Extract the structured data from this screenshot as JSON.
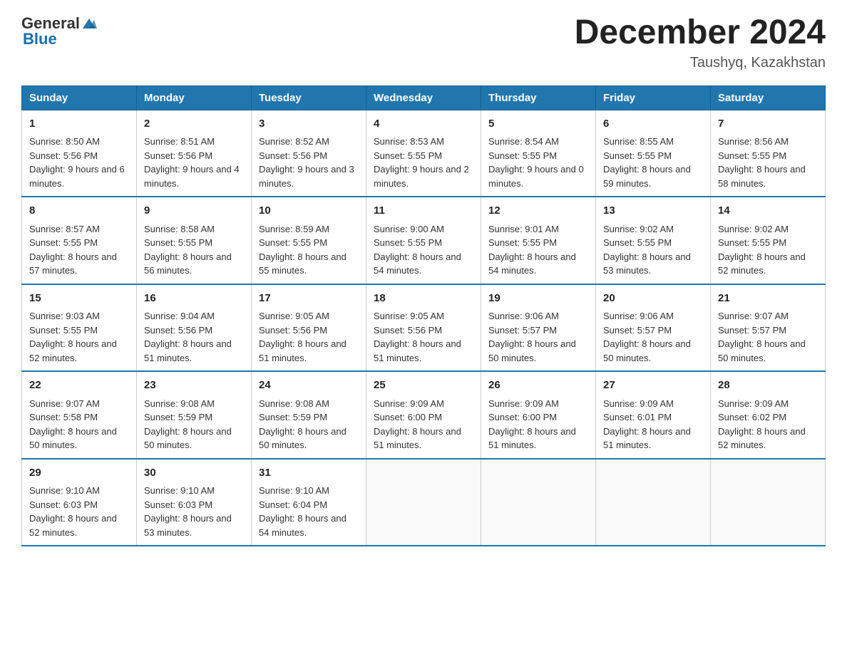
{
  "header": {
    "logo_general": "General",
    "logo_blue": "Blue",
    "title": "December 2024",
    "location": "Taushyq, Kazakhstan"
  },
  "days_of_week": [
    "Sunday",
    "Monday",
    "Tuesday",
    "Wednesday",
    "Thursday",
    "Friday",
    "Saturday"
  ],
  "weeks": [
    [
      {
        "day": "1",
        "sunrise": "Sunrise: 8:50 AM",
        "sunset": "Sunset: 5:56 PM",
        "daylight": "Daylight: 9 hours and 6 minutes."
      },
      {
        "day": "2",
        "sunrise": "Sunrise: 8:51 AM",
        "sunset": "Sunset: 5:56 PM",
        "daylight": "Daylight: 9 hours and 4 minutes."
      },
      {
        "day": "3",
        "sunrise": "Sunrise: 8:52 AM",
        "sunset": "Sunset: 5:56 PM",
        "daylight": "Daylight: 9 hours and 3 minutes."
      },
      {
        "day": "4",
        "sunrise": "Sunrise: 8:53 AM",
        "sunset": "Sunset: 5:55 PM",
        "daylight": "Daylight: 9 hours and 2 minutes."
      },
      {
        "day": "5",
        "sunrise": "Sunrise: 8:54 AM",
        "sunset": "Sunset: 5:55 PM",
        "daylight": "Daylight: 9 hours and 0 minutes."
      },
      {
        "day": "6",
        "sunrise": "Sunrise: 8:55 AM",
        "sunset": "Sunset: 5:55 PM",
        "daylight": "Daylight: 8 hours and 59 minutes."
      },
      {
        "day": "7",
        "sunrise": "Sunrise: 8:56 AM",
        "sunset": "Sunset: 5:55 PM",
        "daylight": "Daylight: 8 hours and 58 minutes."
      }
    ],
    [
      {
        "day": "8",
        "sunrise": "Sunrise: 8:57 AM",
        "sunset": "Sunset: 5:55 PM",
        "daylight": "Daylight: 8 hours and 57 minutes."
      },
      {
        "day": "9",
        "sunrise": "Sunrise: 8:58 AM",
        "sunset": "Sunset: 5:55 PM",
        "daylight": "Daylight: 8 hours and 56 minutes."
      },
      {
        "day": "10",
        "sunrise": "Sunrise: 8:59 AM",
        "sunset": "Sunset: 5:55 PM",
        "daylight": "Daylight: 8 hours and 55 minutes."
      },
      {
        "day": "11",
        "sunrise": "Sunrise: 9:00 AM",
        "sunset": "Sunset: 5:55 PM",
        "daylight": "Daylight: 8 hours and 54 minutes."
      },
      {
        "day": "12",
        "sunrise": "Sunrise: 9:01 AM",
        "sunset": "Sunset: 5:55 PM",
        "daylight": "Daylight: 8 hours and 54 minutes."
      },
      {
        "day": "13",
        "sunrise": "Sunrise: 9:02 AM",
        "sunset": "Sunset: 5:55 PM",
        "daylight": "Daylight: 8 hours and 53 minutes."
      },
      {
        "day": "14",
        "sunrise": "Sunrise: 9:02 AM",
        "sunset": "Sunset: 5:55 PM",
        "daylight": "Daylight: 8 hours and 52 minutes."
      }
    ],
    [
      {
        "day": "15",
        "sunrise": "Sunrise: 9:03 AM",
        "sunset": "Sunset: 5:55 PM",
        "daylight": "Daylight: 8 hours and 52 minutes."
      },
      {
        "day": "16",
        "sunrise": "Sunrise: 9:04 AM",
        "sunset": "Sunset: 5:56 PM",
        "daylight": "Daylight: 8 hours and 51 minutes."
      },
      {
        "day": "17",
        "sunrise": "Sunrise: 9:05 AM",
        "sunset": "Sunset: 5:56 PM",
        "daylight": "Daylight: 8 hours and 51 minutes."
      },
      {
        "day": "18",
        "sunrise": "Sunrise: 9:05 AM",
        "sunset": "Sunset: 5:56 PM",
        "daylight": "Daylight: 8 hours and 51 minutes."
      },
      {
        "day": "19",
        "sunrise": "Sunrise: 9:06 AM",
        "sunset": "Sunset: 5:57 PM",
        "daylight": "Daylight: 8 hours and 50 minutes."
      },
      {
        "day": "20",
        "sunrise": "Sunrise: 9:06 AM",
        "sunset": "Sunset: 5:57 PM",
        "daylight": "Daylight: 8 hours and 50 minutes."
      },
      {
        "day": "21",
        "sunrise": "Sunrise: 9:07 AM",
        "sunset": "Sunset: 5:57 PM",
        "daylight": "Daylight: 8 hours and 50 minutes."
      }
    ],
    [
      {
        "day": "22",
        "sunrise": "Sunrise: 9:07 AM",
        "sunset": "Sunset: 5:58 PM",
        "daylight": "Daylight: 8 hours and 50 minutes."
      },
      {
        "day": "23",
        "sunrise": "Sunrise: 9:08 AM",
        "sunset": "Sunset: 5:59 PM",
        "daylight": "Daylight: 8 hours and 50 minutes."
      },
      {
        "day": "24",
        "sunrise": "Sunrise: 9:08 AM",
        "sunset": "Sunset: 5:59 PM",
        "daylight": "Daylight: 8 hours and 50 minutes."
      },
      {
        "day": "25",
        "sunrise": "Sunrise: 9:09 AM",
        "sunset": "Sunset: 6:00 PM",
        "daylight": "Daylight: 8 hours and 51 minutes."
      },
      {
        "day": "26",
        "sunrise": "Sunrise: 9:09 AM",
        "sunset": "Sunset: 6:00 PM",
        "daylight": "Daylight: 8 hours and 51 minutes."
      },
      {
        "day": "27",
        "sunrise": "Sunrise: 9:09 AM",
        "sunset": "Sunset: 6:01 PM",
        "daylight": "Daylight: 8 hours and 51 minutes."
      },
      {
        "day": "28",
        "sunrise": "Sunrise: 9:09 AM",
        "sunset": "Sunset: 6:02 PM",
        "daylight": "Daylight: 8 hours and 52 minutes."
      }
    ],
    [
      {
        "day": "29",
        "sunrise": "Sunrise: 9:10 AM",
        "sunset": "Sunset: 6:03 PM",
        "daylight": "Daylight: 8 hours and 52 minutes."
      },
      {
        "day": "30",
        "sunrise": "Sunrise: 9:10 AM",
        "sunset": "Sunset: 6:03 PM",
        "daylight": "Daylight: 8 hours and 53 minutes."
      },
      {
        "day": "31",
        "sunrise": "Sunrise: 9:10 AM",
        "sunset": "Sunset: 6:04 PM",
        "daylight": "Daylight: 8 hours and 54 minutes."
      },
      null,
      null,
      null,
      null
    ]
  ]
}
